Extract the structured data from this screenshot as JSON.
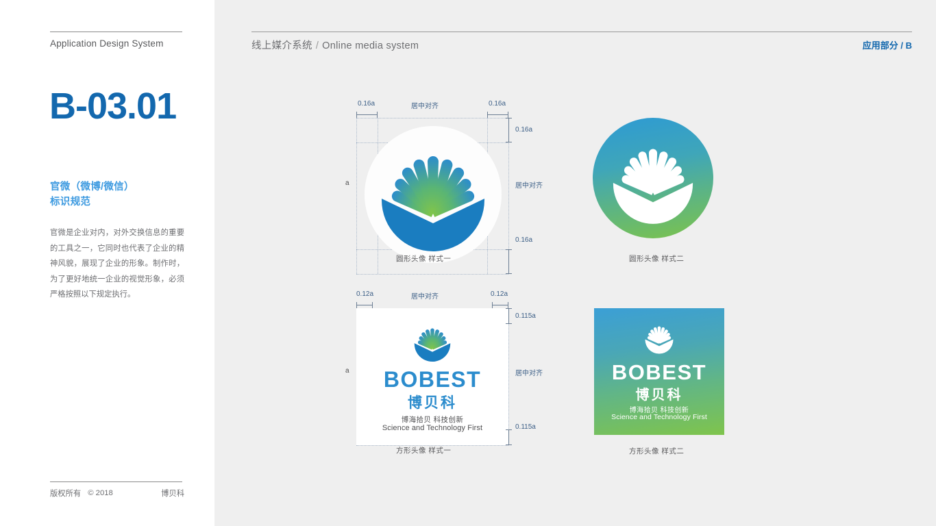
{
  "sidebar": {
    "app_title": "Application Design System",
    "code": "B-03.01",
    "section_title_line1": "官微（微博/微信）",
    "section_title_line2": "标识规范",
    "body": "官微是企业对内，对外交换信息的重要的工具之一，它同时也代表了企业的精神风貌，展现了企业的形象。制作时，为了更好地统一企业的视觉形象，必须严格按照以下规定执行。",
    "footer": {
      "copyright_label": "版权所有",
      "copyright_year": "© 2018",
      "brand": "博贝科"
    }
  },
  "header": {
    "title_cn": "线上媒介系统",
    "separator": "/",
    "title_en": "Online media system",
    "section_right": "应用部分 / B",
    "accent": "#1368ae"
  },
  "specs": {
    "circle": {
      "pad_left": "0.16a",
      "pad_right": "0.16a",
      "pad_top": "0.16a",
      "pad_bottom": "0.16a",
      "align_top": "居中对齐",
      "align_right": "居中对齐",
      "size": "a"
    },
    "square": {
      "pad_left": "0.12a",
      "pad_right": "0.12a",
      "pad_top": "0.115a",
      "pad_bottom": "0.115a",
      "align_top": "居中对齐",
      "align_right": "居中对齐",
      "size": "a"
    }
  },
  "captions": {
    "circle_style_1": "圆形头像  样式一",
    "circle_style_2": "圆形头像  样式二",
    "square_style_1": "方形头像  样式一",
    "square_style_2": "方形头像  样式二"
  },
  "logo": {
    "latin": "BOBEST",
    "chinese": "博贝科",
    "tagline_cn": "博海拾贝  科技创新",
    "tagline_en": "Science and Technology First",
    "colors": {
      "blue": "#2b8ccd",
      "green": "#7fc44c",
      "deep_blue": "#1a7dc0",
      "grad_start": "#2d9ad4",
      "grad_end": "#7cc34b"
    }
  },
  "page": {
    "sidebar_bg": "#ffffff",
    "main_bg": "#efefef"
  }
}
